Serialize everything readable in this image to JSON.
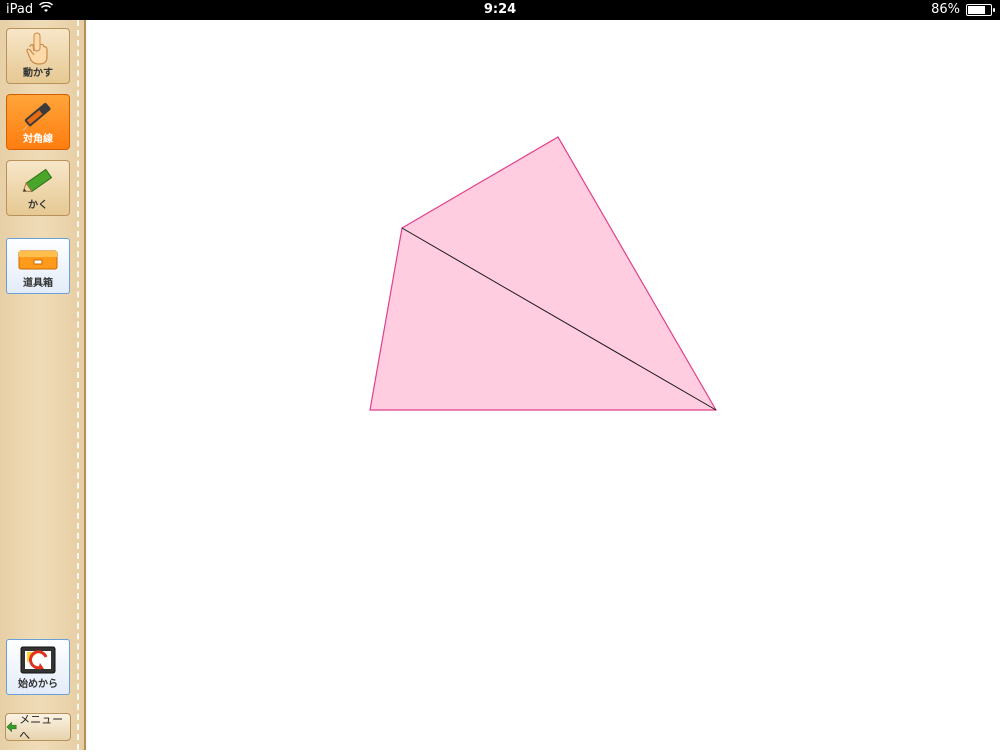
{
  "status_bar": {
    "device": "iPad",
    "time": "9:24",
    "battery": "86%",
    "battery_level": 0.86
  },
  "sidebar": {
    "tools": [
      {
        "label": "動かす",
        "icon": "hand-pointer-icon",
        "active": false
      },
      {
        "label": "対角線",
        "icon": "cutter-knife-icon",
        "active": true
      },
      {
        "label": "かく",
        "icon": "pencil-icon",
        "active": false
      }
    ],
    "toolbox": {
      "label": "道具箱",
      "icon": "toolbox-drawer-icon"
    },
    "restart": {
      "label": "始めから",
      "icon": "restart-icon"
    },
    "menu": {
      "label": "メニューへ",
      "icon": "green-arrow-left-icon"
    }
  },
  "colors": {
    "shape_fill": "#ffcce0",
    "shape_stroke": "#e0408a",
    "diagonal": "#1a1a1a",
    "active_tool": "#ff8a1e"
  }
}
